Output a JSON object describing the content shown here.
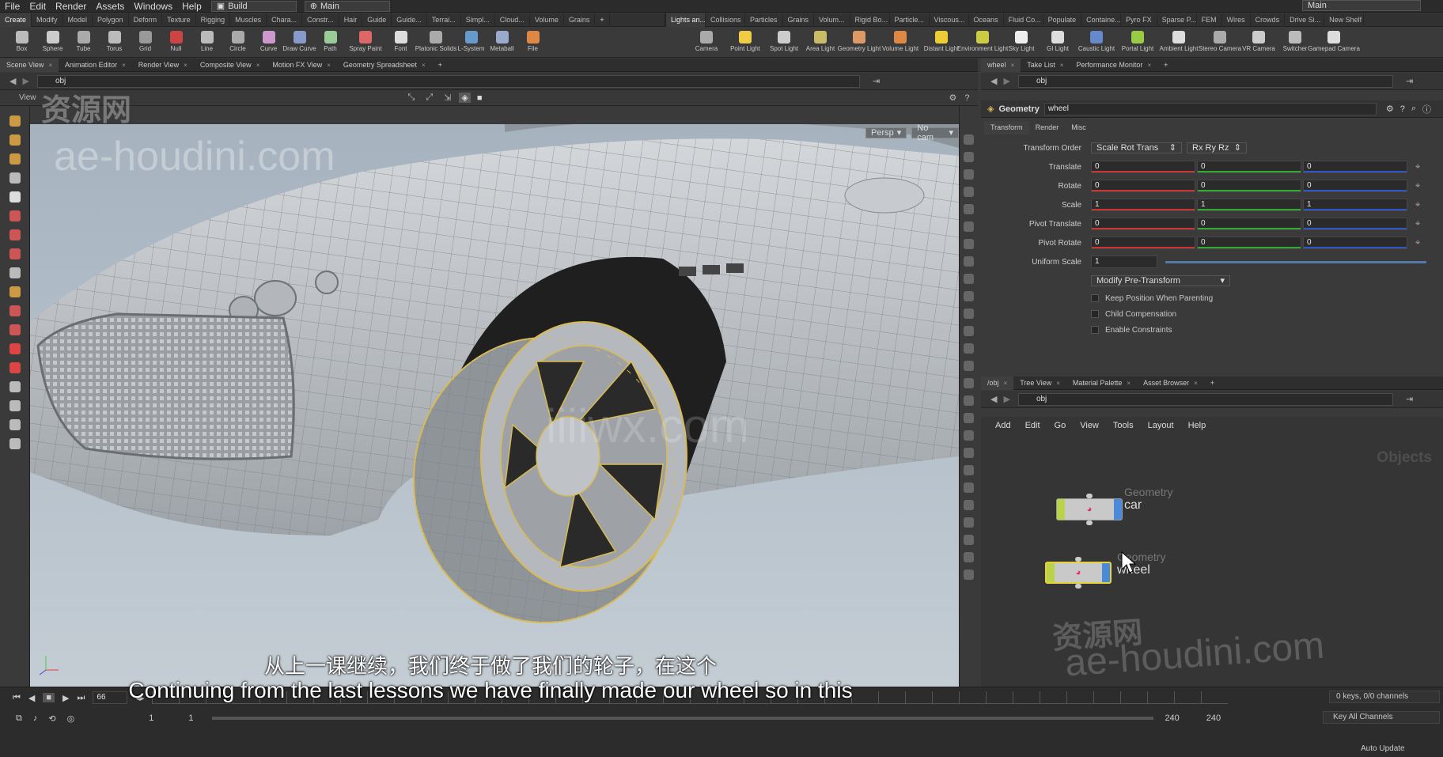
{
  "menubar": {
    "items": [
      "File",
      "Edit",
      "Render",
      "Assets",
      "Windows",
      "Help"
    ],
    "desktop": "Build",
    "context": "Main",
    "right_context": "Main"
  },
  "shelf_tabs": [
    "Create",
    "Modify",
    "Model",
    "Polygon",
    "Deform",
    "Texture",
    "Rigging",
    "Muscles",
    "Chara...",
    "Constr...",
    "Hair",
    "Guide",
    "Guide...",
    "Terrai...",
    "Simpl...",
    "Cloud...",
    "Volume",
    "Grains"
  ],
  "shelf_tabs_right": [
    "Lights an...",
    "Collisions",
    "Particles",
    "Grains",
    "Volum...",
    "Rigid Bo...",
    "Particle...",
    "Viscous...",
    "Oceans",
    "Fluid Co...",
    "Populate",
    "Containe...",
    "Pyro FX",
    "Sparse P...",
    "FEM",
    "Wires",
    "Crowds",
    "Drive Si...",
    "New Shelf"
  ],
  "tools_left": [
    "Box",
    "Sphere",
    "Tube",
    "Torus",
    "Grid",
    "Null",
    "Line",
    "Circle",
    "Curve",
    "Draw Curve",
    "Path",
    "Spray Paint",
    "Font",
    "Platonic Solids",
    "L-System",
    "Metaball",
    "File"
  ],
  "tools_right": [
    "Camera",
    "Point Light",
    "Spot Light",
    "Area Light",
    "Geometry Light",
    "Volume Light",
    "Distant Light",
    "Environment Light",
    "Sky Light",
    "GI Light",
    "Caustic Light",
    "Portal Light",
    "Ambient Light",
    "Stereo Camera",
    "VR Camera",
    "Switcher",
    "Gamepad Camera"
  ],
  "left_pane": {
    "tabs": [
      "Scene View",
      "Animation Editor",
      "Render View",
      "Composite View",
      "Motion FX View",
      "Geometry Spreadsheet"
    ],
    "path": "obj",
    "view_label": "View",
    "persp": "Persp",
    "cam": "No cam"
  },
  "right_pane": {
    "tabs": [
      "wheel",
      "Take List",
      "Performance Monitor"
    ],
    "path": "obj",
    "node_type": "Geometry",
    "node_name": "wheel",
    "param_tabs": [
      "Transform",
      "Render",
      "Misc"
    ],
    "transform_order_label": "Transform Order",
    "transform_order": "Scale Rot Trans",
    "rot_order": "Rx Ry Rz",
    "rows": [
      {
        "label": "Translate",
        "v": [
          "0",
          "0",
          "0"
        ]
      },
      {
        "label": "Rotate",
        "v": [
          "0",
          "0",
          "0"
        ]
      },
      {
        "label": "Scale",
        "v": [
          "1",
          "1",
          "1"
        ]
      },
      {
        "label": "Pivot Translate",
        "v": [
          "0",
          "0",
          "0"
        ]
      },
      {
        "label": "Pivot Rotate",
        "v": [
          "0",
          "0",
          "0"
        ]
      }
    ],
    "uniform_scale_label": "Uniform Scale",
    "uniform_scale": "1",
    "modify_btn": "Modify Pre-Transform",
    "checks": [
      "Keep Position When Parenting",
      "Child Compensation",
      "Enable Constraints"
    ]
  },
  "network": {
    "tabs": [
      "/obj",
      "Tree View",
      "Material Palette",
      "Asset Browser"
    ],
    "path": "obj",
    "menu": [
      "Add",
      "Edit",
      "Go",
      "View",
      "Tools",
      "Layout",
      "Help"
    ],
    "context_label": "Objects",
    "nodes": [
      {
        "type": "Geometry",
        "name": "car"
      },
      {
        "type": "Geometry",
        "name": "wheel"
      }
    ]
  },
  "timeline": {
    "frame": "66",
    "start": "1",
    "start2": "1",
    "end": "240",
    "end2": "240",
    "keys": "0 keys, 0/0 channels",
    "key_all": "Key All Channels",
    "auto_update": "Auto Update"
  },
  "subtitle": {
    "cn": "从上一课继续，我们终于做了我们的轮子，在这个",
    "en": "Continuing from the last lessons we have finally made our wheel so in this"
  },
  "watermarks": {
    "w1": "资源网",
    "w2": "ae-houdini.com",
    "w3": "iiiiwx.com",
    "w4": "资源网",
    "w5": "ae-houdini.com"
  }
}
